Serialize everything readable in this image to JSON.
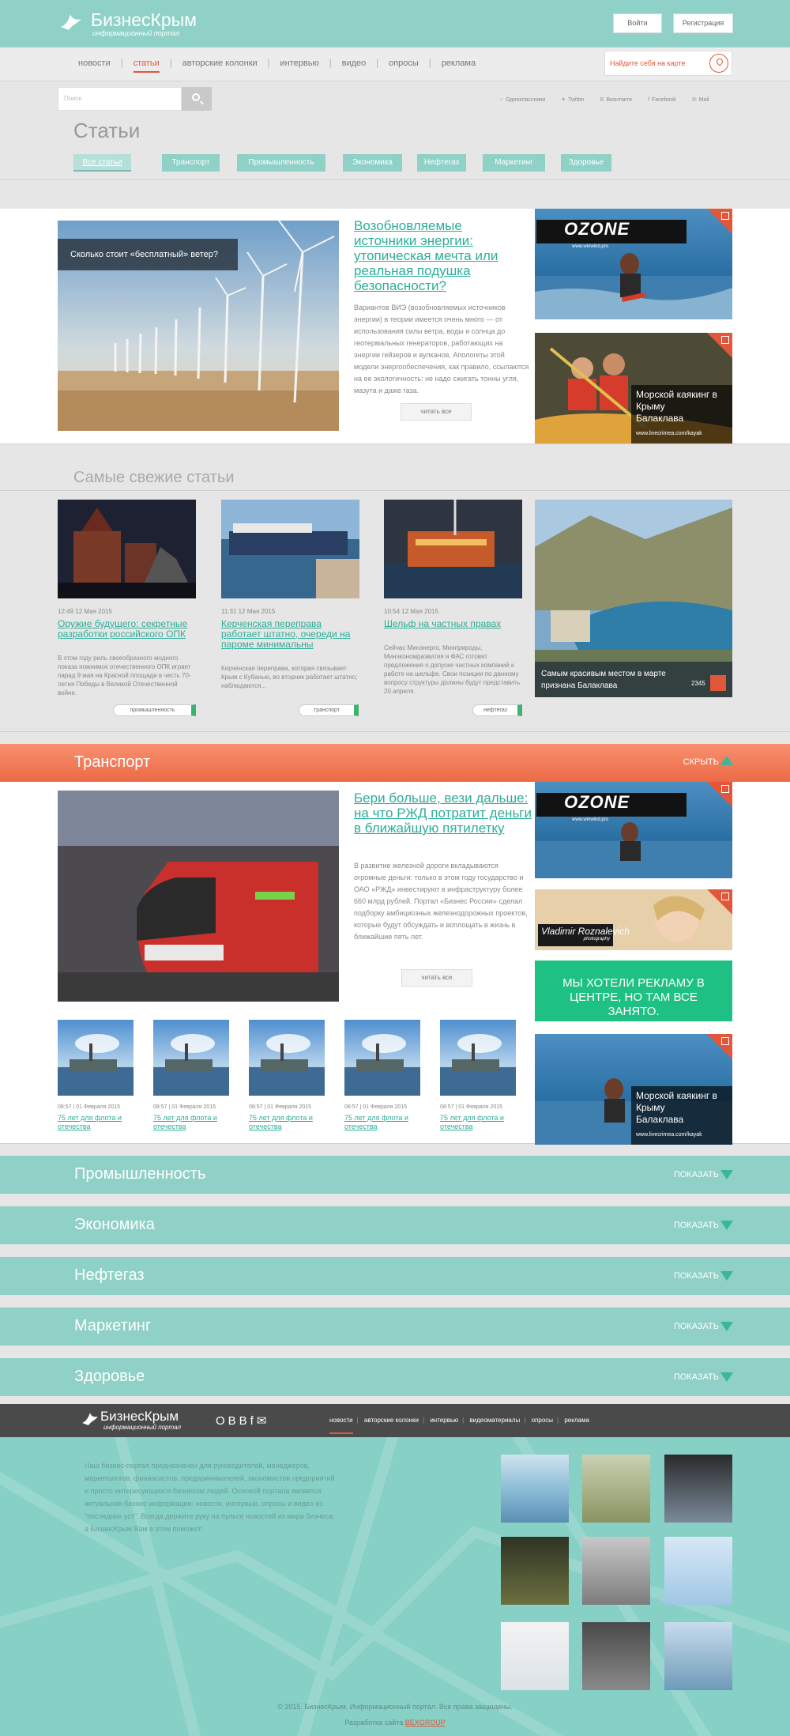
{
  "header": {
    "logo_title": "БизнесКрым",
    "logo_subtitle": "информационный портал",
    "login": "Войти",
    "register": "Регистрация"
  },
  "nav": {
    "items": [
      "новости",
      "статьи",
      "авторские колонки",
      "интервью",
      "видео",
      "опросы",
      "реклама"
    ],
    "active": "статьи",
    "map_label": "Найдите себя на карте"
  },
  "search": {
    "placeholder": "Поиск"
  },
  "socials": [
    "Одноклассники",
    "Twitter",
    "Вконтакте",
    "Facebook",
    "Mail"
  ],
  "page_title": "Статьи",
  "categories": [
    "Все статьи",
    "Транспорт",
    "Промышленность",
    "Экономика",
    "Нефтегаз",
    "Маркетинг",
    "Здоровье"
  ],
  "featured": {
    "image_caption": "Сколько стоит «бесплатный» ветер?",
    "title": "Возобновляемые источники энергии: утопическая мечта или реальная подушка безопасности?",
    "text": "Вариантов ВИЭ (возобновляемых источников энергии) в теории имеется очень много — от использования силы ветра, воды и солнца до геотермальных генераторов, работающих на энергии гейзеров и вулканов. Апологеты этой модели энергообеспечения, как правило, ссылаются на ее экологичность: не надо сжигать тонны угля, мазута и даже газа.",
    "more": "читать все"
  },
  "ads": {
    "ozone_brand": "OZONE",
    "ozone_site": "www.winwind.pro",
    "kayak_title": "Морской каякинг в Крыму",
    "kayak_place": "Балаклава",
    "kayak_site": "www.livecrimea.com/kayak",
    "photographer_name": "Vladimir Roznalevich",
    "photographer_sub": "photography",
    "green_ad": "МЫ ХОТЕЛИ РЕКЛАМУ В ЦЕНТРЕ, НО ТАМ ВСЕ ЗАНЯТО."
  },
  "fresh": {
    "title": "Самые свежие статьи",
    "cards": [
      {
        "date": "12:49  12 Мая 2015",
        "title": "Оружие будущего: секретные разработки российского ОПК",
        "text": "В этом году риль своеобразного модного показа ножнимок отечественного ОПК играет парад 9 мая на Красной площади в честь 70-летия Победы в Великой Отечественной войне.",
        "tag": "промышленность"
      },
      {
        "date": "11:31  12 Мая 2015",
        "title": "Керченская переправа работает штатно, очереди на пароме минимальны",
        "text": "Керченская переправа, которая связывает Крым с Кубанью, во вторник работает штатно; наблюдаются...",
        "tag": "транспорт"
      },
      {
        "date": "10:54  12 Мая 2015",
        "title": "Шельф на частных правах",
        "text": "Сейчас Минэнерго, Минприроды, Минэкономразвития и ФАС готовят предложения о допуске частных компаний к работе на шельфе. Свои позиции по данному вопросу структуры должны будут представить 20 апреля.",
        "tag": "нефтегаз"
      }
    ],
    "side": {
      "title": "Самым красивым местом в марте признана Балаклава",
      "count": "2345"
    }
  },
  "transport": {
    "title": "Транспорт",
    "hide": "СКРЫТЬ",
    "main_title": "Бери больше, вези дальше: на что РЖД потратит деньги в ближайшую пятилетку",
    "main_text": "В развитие железной дороги вкладываются огромные деньги: только в этом году государство и ОАО «РЖД» инвестируют в инфраструктуру более 660 млрд рублей. Портал «Бизнес России» сделал подборку амбициозных железнодорожных проектов, которые будут обсуждать и воплощать в жизнь в ближайшие пять лет.",
    "more": "читать все",
    "small": [
      {
        "date": "08:57  |  01 Февраля 2015",
        "title": "75 лет для флота и отечества"
      },
      {
        "date": "08:57  |  01 Февраля 2015",
        "title": "75 лет для флота и отечества"
      },
      {
        "date": "08:57  |  01 Февраля 2015",
        "title": "75 лет для флота и отечества"
      },
      {
        "date": "08:57  |  01 Февраля 2015",
        "title": "75 лет для флота и отечества"
      },
      {
        "date": "08:57  |  01 Февраля 2015",
        "title": "75 лет для флота и отечества"
      }
    ]
  },
  "bands": [
    {
      "title": "Промышленность",
      "action": "ПОКАЗАТЬ"
    },
    {
      "title": "Экономика",
      "action": "ПОКАЗАТЬ"
    },
    {
      "title": "Нефтегаз",
      "action": "ПОКАЗАТЬ"
    },
    {
      "title": "Маркетинг",
      "action": "ПОКАЗАТЬ"
    },
    {
      "title": "Здоровье",
      "action": "ПОКАЗАТЬ"
    }
  ],
  "footer": {
    "logo_title": "БизнесКрым",
    "logo_subtitle": "информационный портал",
    "social_glyphs": "ОВBf✉",
    "nav": [
      "новости",
      "авторские колонки",
      "интервью",
      "видеоматериалы",
      "опросы",
      "реклама"
    ],
    "text": "Наш бизнес-портал предназначен для руководителей, менеджеров, маркетологов, финансистов, предпринимателей, экономистов предприятий и просто интересующихся бизнесом людей. Основой портала является актуальная бизнес-информация: новости, интервью, опросы и видео из \"последних уст\". Всегда держите руку на пульсе новостей из мира бизнеса, а БизнесКрым Вам в этом поможет!",
    "copyright": "© 2015. БизнесКрым. Информационный портал. Все права защищены.",
    "dev_prefix": "Разработка сайта",
    "dev_link": "BEXGROUP"
  }
}
